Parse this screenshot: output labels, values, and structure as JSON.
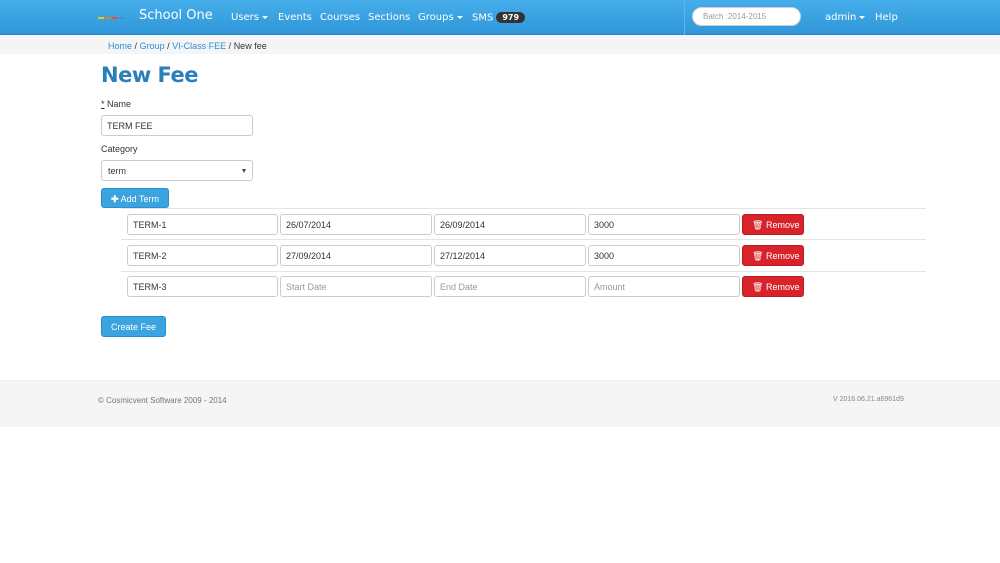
{
  "navbar": {
    "brand": "School One",
    "items": [
      {
        "label": "Users",
        "dropdown": true
      },
      {
        "label": "Events",
        "dropdown": false
      },
      {
        "label": "Courses",
        "dropdown": false
      },
      {
        "label": "Sections",
        "dropdown": false
      },
      {
        "label": "Groups",
        "dropdown": true
      },
      {
        "label": "SMS",
        "dropdown": false
      }
    ],
    "sms_count": "979",
    "batch_placeholder": "Batch :2014-2015",
    "user_label": "admin",
    "help_label": "Help",
    "colors": {
      "bar": "#3aa3e0",
      "logo": [
        "#f1c40f",
        "#e67e22",
        "#e74c3c",
        "#3498db"
      ]
    }
  },
  "breadcrumb": {
    "links": [
      "Home",
      "Group",
      "VI-Class FEE"
    ],
    "separator": "/",
    "current": "New fee"
  },
  "form": {
    "title": "New Fee",
    "name_required_mark": "*",
    "name_label": "Name",
    "name_value": "TERM FEE",
    "category_label": "Category",
    "category_value": "term",
    "add_term_label": "Add Term",
    "add_term_icon": "plus-icon",
    "terms": [
      {
        "name": "TERM-1",
        "start": "26/07/2014",
        "end": "26/09/2014",
        "amount": "3000"
      },
      {
        "name": "TERM-2",
        "start": "27/09/2014",
        "end": "27/12/2014",
        "amount": "3000"
      },
      {
        "name": "TERM-3",
        "start": "",
        "end": "",
        "amount": ""
      }
    ],
    "placeholders": {
      "start": "Start Date",
      "end": "End Date",
      "amount": "Amount"
    },
    "remove_label": "Remove",
    "remove_icon": "trash-icon",
    "submit_label": "Create Fee",
    "colors": {
      "primary": "#3aa3e0",
      "danger": "#d9232a",
      "title": "#2a7fb8"
    }
  },
  "footer": {
    "copyright": "© Cosmicvent Software 2009 - 2014",
    "version": "V 2016.06.21.a6961d9"
  }
}
